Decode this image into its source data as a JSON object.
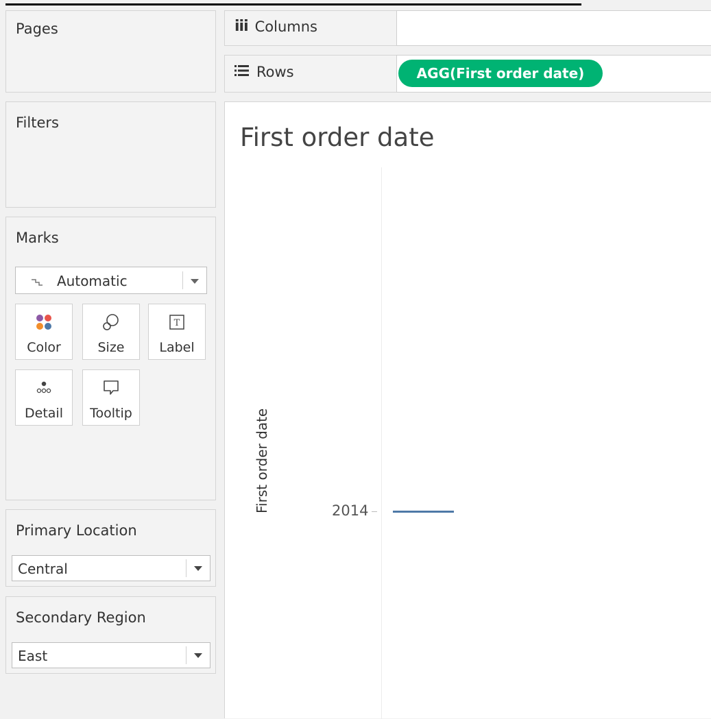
{
  "pages": {
    "label": "Pages"
  },
  "filters": {
    "label": "Filters"
  },
  "shelves": {
    "columns": {
      "label": "Columns",
      "icon": "columns-icon"
    },
    "rows": {
      "label": "Rows",
      "icon": "rows-icon",
      "pill": "AGG(First order date)"
    }
  },
  "marks": {
    "label": "Marks",
    "type": "Automatic",
    "buttons": [
      {
        "label": "Color",
        "icon": "color-icon"
      },
      {
        "label": "Size",
        "icon": "size-icon"
      },
      {
        "label": "Label",
        "icon": "label-icon"
      },
      {
        "label": "Detail",
        "icon": "detail-icon"
      },
      {
        "label": "Tooltip",
        "icon": "tooltip-icon"
      }
    ]
  },
  "parameters": [
    {
      "label": "Primary Location",
      "value": "Central"
    },
    {
      "label": "Secondary Region",
      "value": "East"
    }
  ],
  "view": {
    "title": "First order date",
    "axis_title": "First order date",
    "tick_label": "2014"
  },
  "colors": {
    "pill": "#00b373",
    "mark": "#4e79a7"
  }
}
